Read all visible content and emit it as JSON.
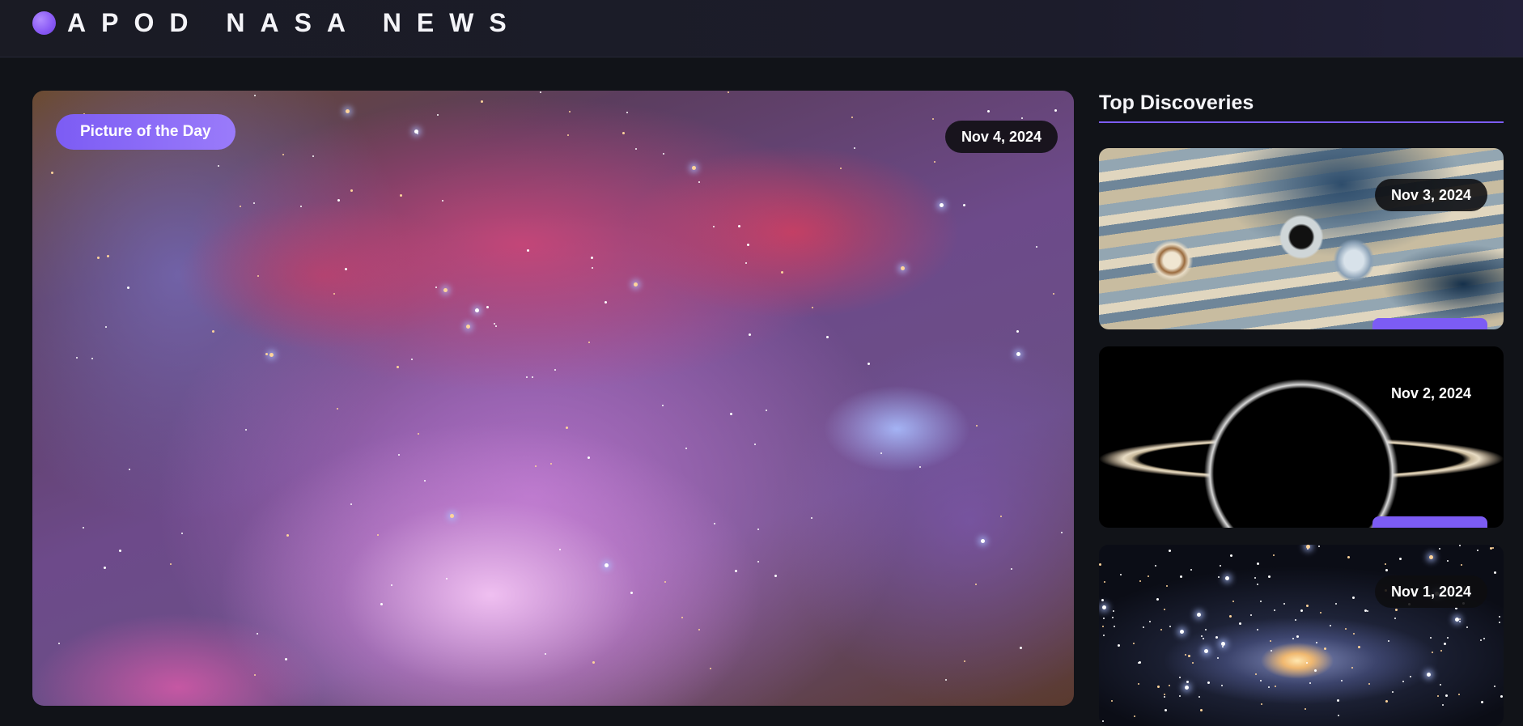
{
  "header": {
    "brand": "APOD NASA NEWS"
  },
  "hero": {
    "badge": "Picture of the Day",
    "date": "Nov 4, 2024"
  },
  "sidebar": {
    "title": "Top Discoveries",
    "cards": [
      {
        "date": "Nov 3, 2024"
      },
      {
        "date": "Nov 2, 2024"
      },
      {
        "date": "Nov 1, 2024"
      }
    ]
  },
  "colors": {
    "accent": "#7c5cf4",
    "background": "#111318",
    "header": "#1a1b24"
  }
}
